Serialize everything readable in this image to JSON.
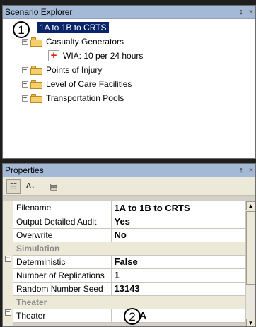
{
  "explorer": {
    "title": "Scenario Explorer",
    "pin_glyph": "↕",
    "close_glyph": "×",
    "tree": {
      "root": "1A to 1B to CRTS",
      "children": [
        {
          "label": "Casualty Generators",
          "expanded": true,
          "expander": "−",
          "children": [
            {
              "label": "WIA: 10 per 24 hours"
            }
          ]
        },
        {
          "label": "Points of Injury",
          "expanded": false,
          "expander": "+"
        },
        {
          "label": "Level of Care Facilities",
          "expanded": false,
          "expander": "+"
        },
        {
          "label": "Transportation Pools",
          "expanded": false,
          "expander": "+"
        }
      ]
    }
  },
  "callouts": {
    "one": "1",
    "two": "2"
  },
  "properties": {
    "title": "Properties",
    "pin_glyph": "↕",
    "close_glyph": "×",
    "toolbar": {
      "categorized_glyph": "☷",
      "alphabetical_glyph": "A↓",
      "pages_glyph": "▤"
    },
    "rows": [
      {
        "name": "Filename",
        "value": "1A to 1B to CRTS"
      },
      {
        "name": "Output Detailed Audit",
        "value": "Yes"
      },
      {
        "name": "Overwrite",
        "value": "No"
      }
    ],
    "categories": [
      {
        "label": "Simulation",
        "toggle": "−",
        "rows": [
          {
            "name": "Deterministic",
            "value": "False"
          },
          {
            "name": "Number of Replications",
            "value": "1"
          },
          {
            "name": "Random Number Seed",
            "value": "13143"
          }
        ]
      },
      {
        "label": "Theater",
        "toggle": "−",
        "rows": [
          {
            "name": "Theater",
            "value": "NEA"
          }
        ]
      }
    ],
    "scrollbar": {
      "up": "▲",
      "down": "▼"
    }
  }
}
